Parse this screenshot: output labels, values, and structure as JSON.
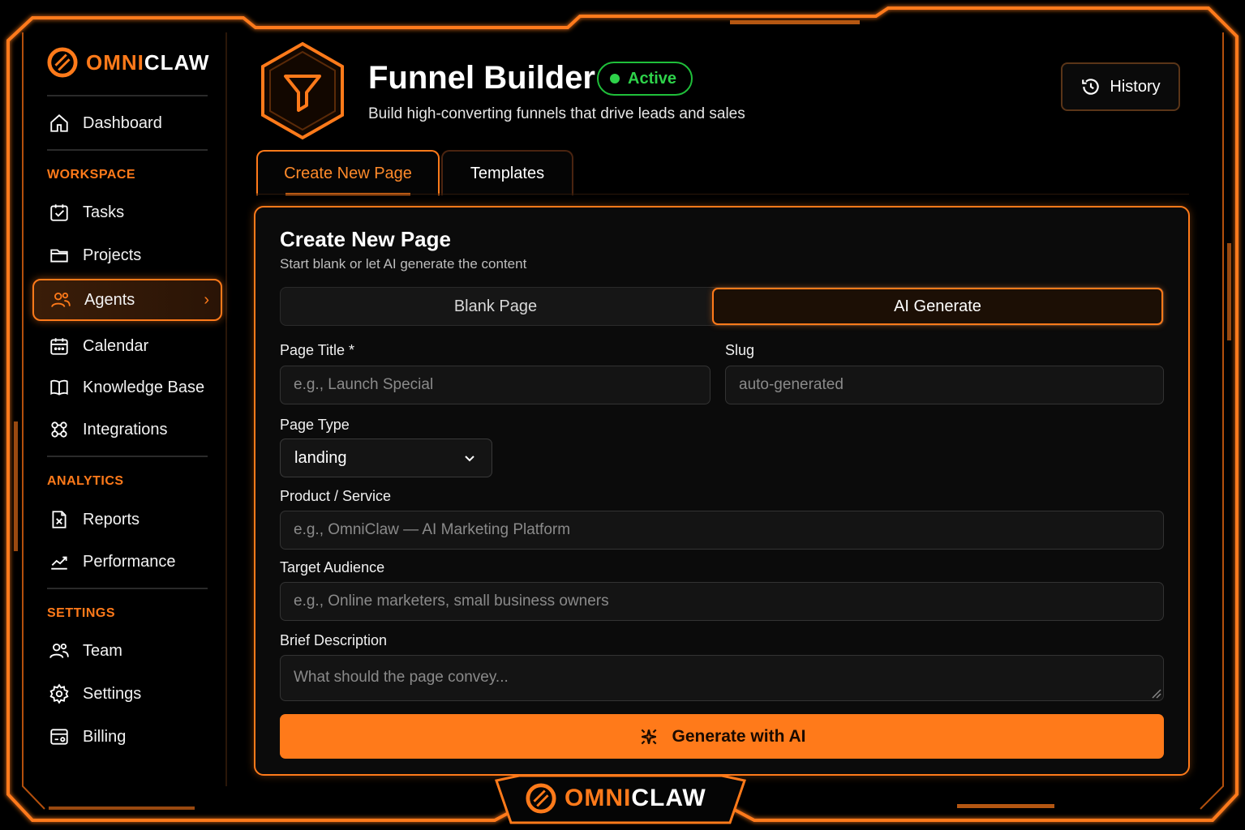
{
  "brand": {
    "name_part1": "OMNI",
    "name_part2": "CLAW",
    "accent": "#ff7a1a"
  },
  "sidebar": {
    "dashboard": {
      "label": "Dashboard",
      "icon": "home-icon"
    },
    "sections": {
      "workspace": "WORKSPACE",
      "analytics": "ANALYTICS",
      "settings": "SETTINGS"
    },
    "items": {
      "tasks": {
        "label": "Tasks",
        "icon": "checklist-icon"
      },
      "projects": {
        "label": "Projects",
        "icon": "folder-icon"
      },
      "agents": {
        "label": "Agents",
        "icon": "users-icon",
        "active": true
      },
      "calendar": {
        "label": "Calendar",
        "icon": "calendar-icon"
      },
      "knowledge": {
        "label": "Knowledge Base",
        "icon": "book-icon"
      },
      "integrations": {
        "label": "Integrations",
        "icon": "integrations-icon"
      },
      "reports": {
        "label": "Reports",
        "icon": "report-icon"
      },
      "performance": {
        "label": "Performance",
        "icon": "chart-line-icon"
      },
      "team": {
        "label": "Team",
        "icon": "team-icon"
      },
      "settings": {
        "label": "Settings",
        "icon": "gear-icon"
      },
      "billing": {
        "label": "Billing",
        "icon": "billing-icon"
      }
    }
  },
  "header": {
    "title": "Funnel Builder",
    "status": "Active",
    "status_color": "#2ed24a",
    "subtitle": "Build high-converting funnels that drive leads and sales",
    "history_label": "History"
  },
  "tabs": {
    "create": "Create New Page",
    "templates": "Templates"
  },
  "form": {
    "title": "Create New Page",
    "subtitle": "Start blank or let AI generate the content",
    "mode_blank": "Blank Page",
    "mode_ai": "AI Generate",
    "page_title_label": "Page Title *",
    "page_title_placeholder": "e.g., Launch Special",
    "slug_label": "Slug",
    "slug_placeholder": "auto-generated",
    "page_type_label": "Page Type",
    "page_type_value": "landing",
    "product_label": "Product / Service",
    "product_placeholder": "e.g., OmniClaw — AI Marketing Platform",
    "audience_label": "Target Audience",
    "audience_placeholder": "e.g., Online marketers, small business owners",
    "description_label": "Brief Description",
    "description_placeholder": "What should the page convey...",
    "generate_label": "Generate with AI"
  }
}
